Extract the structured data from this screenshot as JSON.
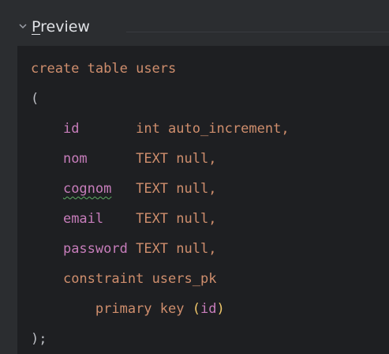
{
  "panel": {
    "title": "Preview",
    "mnemonic_char": "P",
    "title_rest": "review"
  },
  "code": {
    "line1": {
      "kw": "create table",
      "name": "users"
    },
    "line2": "(",
    "columns": [
      {
        "name": "id",
        "pad": "       ",
        "def": "int auto_increment,"
      },
      {
        "name": "nom",
        "pad": "      ",
        "def": "TEXT null,"
      },
      {
        "name": "cognom",
        "pad": "   ",
        "def": "TEXT null,"
      },
      {
        "name": "email",
        "pad": "    ",
        "def": "TEXT null,"
      },
      {
        "name": "password",
        "pad": " ",
        "def": "TEXT null,"
      }
    ],
    "constraint": {
      "kw": "constraint",
      "name": "users_pk"
    },
    "primary": {
      "kw": "primary key",
      "open": "(",
      "col": "id",
      "close": ")"
    },
    "end": ");"
  },
  "colors": {
    "background": "#2b2d30",
    "editor_bg": "#1e1f22",
    "keyword": "#cf8e6d",
    "column": "#c77dbb",
    "text": "#bcbec4",
    "bracket_highlight": "#efc66a"
  },
  "icons": {
    "collapse": "chevron-down-icon"
  }
}
